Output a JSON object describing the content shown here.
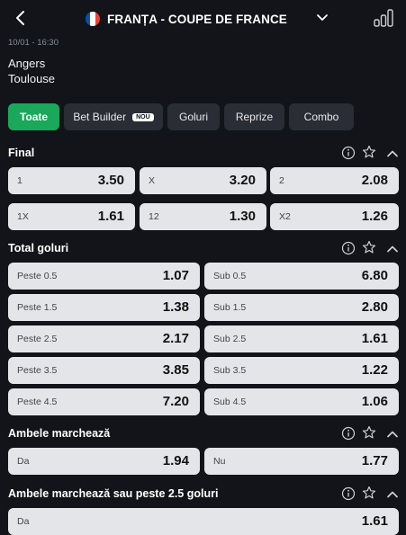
{
  "header": {
    "title": "FRANȚA - COUPE DE FRANCE",
    "flag_colors": [
      "#0055a4",
      "#ffffff",
      "#ef4135"
    ],
    "icons": [
      "back-arrow-icon",
      "france-flag-icon",
      "chevron-down-icon",
      "stats-bars-icon"
    ]
  },
  "match": {
    "datetime": "10/01 - 16:30",
    "home": "Angers",
    "away": "Toulouse"
  },
  "tabs": [
    {
      "label": "Toate",
      "active": true
    },
    {
      "label": "Bet Builder",
      "badge": "NOU"
    },
    {
      "label": "Goluri"
    },
    {
      "label": "Reprize"
    },
    {
      "label": "Combo"
    }
  ],
  "colors": {
    "accent": "#1aa85a",
    "background": "#12141a",
    "odd_bg": "#e4e5e8"
  },
  "markets": {
    "final": {
      "title": "Final",
      "rows": [
        [
          {
            "label": "1",
            "odd": "3.50"
          },
          {
            "label": "X",
            "odd": "3.20"
          },
          {
            "label": "2",
            "odd": "2.08"
          }
        ],
        [
          {
            "label": "1X",
            "odd": "1.61"
          },
          {
            "label": "12",
            "odd": "1.30"
          },
          {
            "label": "X2",
            "odd": "1.26"
          }
        ]
      ]
    },
    "total": {
      "title": "Total goluri",
      "rows": [
        [
          {
            "label": "Peste 0.5",
            "odd": "1.07"
          },
          {
            "label": "Sub 0.5",
            "odd": "6.80"
          }
        ],
        [
          {
            "label": "Peste 1.5",
            "odd": "1.38"
          },
          {
            "label": "Sub 1.5",
            "odd": "2.80"
          }
        ],
        [
          {
            "label": "Peste 2.5",
            "odd": "2.17"
          },
          {
            "label": "Sub 2.5",
            "odd": "1.61"
          }
        ],
        [
          {
            "label": "Peste 3.5",
            "odd": "3.85"
          },
          {
            "label": "Sub 3.5",
            "odd": "1.22"
          }
        ],
        [
          {
            "label": "Peste 4.5",
            "odd": "7.20"
          },
          {
            "label": "Sub 4.5",
            "odd": "1.06"
          }
        ]
      ]
    },
    "btts": {
      "title": "Ambele marchează",
      "rows": [
        [
          {
            "label": "Da",
            "odd": "1.94"
          },
          {
            "label": "Nu",
            "odd": "1.77"
          }
        ]
      ]
    },
    "btts_over": {
      "title": "Ambele marchează sau peste 2.5 goluri",
      "rows": [
        [
          {
            "label": "Da",
            "odd": "1.61"
          }
        ]
      ]
    }
  }
}
